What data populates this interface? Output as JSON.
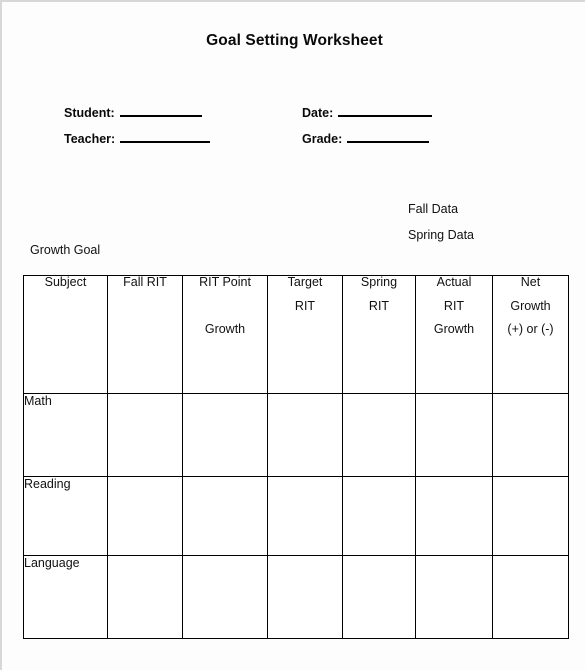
{
  "document": {
    "title": "Goal Setting Worksheet"
  },
  "fields": [
    {
      "label": "Student:",
      "value": "",
      "rule": "short"
    },
    {
      "label": "Teacher:",
      "value": "",
      "rule": "med"
    },
    {
      "label": "Date:",
      "value": "",
      "rule": "long"
    },
    {
      "label": "Grade:",
      "value": "",
      "rule": "short"
    }
  ],
  "annotations": {
    "fall_data": "Fall Data",
    "spring_data": "Spring Data",
    "growth_goal": "Growth Goal"
  },
  "table": {
    "columns": [
      {
        "key": "subject",
        "lines": [
          "Subject"
        ]
      },
      {
        "key": "fall_rit",
        "lines": [
          "Fall RIT"
        ]
      },
      {
        "key": "rit_point_growth",
        "lines": [
          "RIT Point",
          "Growth"
        ]
      },
      {
        "key": "target_rit",
        "lines": [
          "Target",
          "RIT"
        ]
      },
      {
        "key": "spring_rit",
        "lines": [
          "Spring",
          "RIT"
        ]
      },
      {
        "key": "actual_rit_growth",
        "lines": [
          "Actual",
          "RIT",
          "Growth"
        ]
      },
      {
        "key": "net_growth",
        "lines": [
          "Net",
          "Growth",
          "(+) or (-)"
        ]
      }
    ],
    "rows": [
      {
        "subject": "Math",
        "fall_rit": "",
        "rit_point_growth": "",
        "target_rit": "",
        "spring_rit": "",
        "actual_rit_growth": "",
        "net_growth": ""
      },
      {
        "subject": "Reading",
        "fall_rit": "",
        "rit_point_growth": "",
        "target_rit": "",
        "spring_rit": "",
        "actual_rit_growth": "",
        "net_growth": ""
      },
      {
        "subject": "Language",
        "fall_rit": "",
        "rit_point_growth": "",
        "target_rit": "",
        "spring_rit": "",
        "actual_rit_growth": "",
        "net_growth": ""
      }
    ],
    "shaded_columns": [
      "spring_rit",
      "actual_rit_growth",
      "net_growth"
    ]
  },
  "colors": {
    "shaded_cell": "#e3ddcc",
    "border": "#000000",
    "page_background": "#fdfdfd",
    "text": "#111111"
  }
}
